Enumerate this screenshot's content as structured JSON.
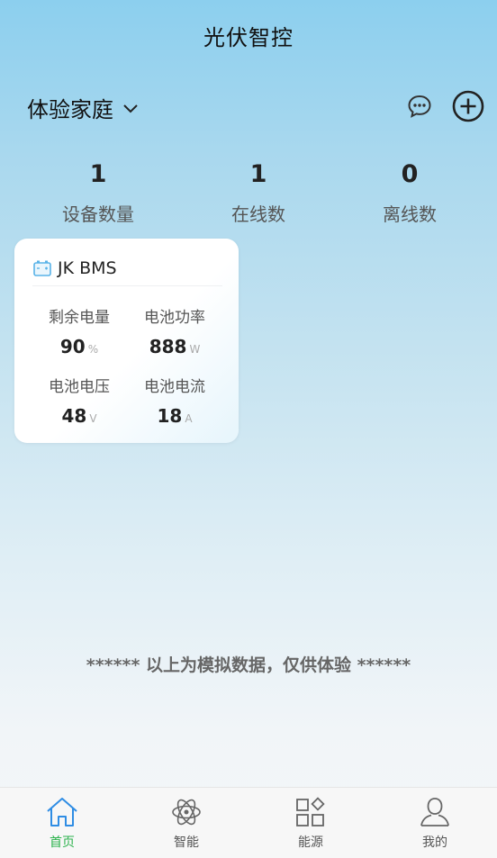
{
  "header": {
    "title": "光伏智控"
  },
  "home": {
    "name": "体验家庭"
  },
  "stats": [
    {
      "value": "1",
      "label": "设备数量"
    },
    {
      "value": "1",
      "label": "在线数"
    },
    {
      "value": "0",
      "label": "离线数"
    }
  ],
  "device": {
    "name": "JK BMS",
    "metrics": [
      {
        "label": "剩余电量",
        "value": "90",
        "unit": "%"
      },
      {
        "label": "电池功率",
        "value": "888",
        "unit": "W"
      },
      {
        "label": "电池电压",
        "value": "48",
        "unit": "V"
      },
      {
        "label": "电池电流",
        "value": "18",
        "unit": "A"
      }
    ]
  },
  "notice": "****** 以上为模拟数据，仅供体验 ******",
  "tabs": [
    {
      "label": "首页",
      "icon": "home-icon",
      "active": true
    },
    {
      "label": "智能",
      "icon": "atom-icon",
      "active": false
    },
    {
      "label": "能源",
      "icon": "grid-icon",
      "active": false
    },
    {
      "label": "我的",
      "icon": "user-icon",
      "active": false
    }
  ],
  "colors": {
    "accent": "#2bb24c",
    "tab_icon_active": "#2f8de4",
    "icon": "#555555"
  }
}
